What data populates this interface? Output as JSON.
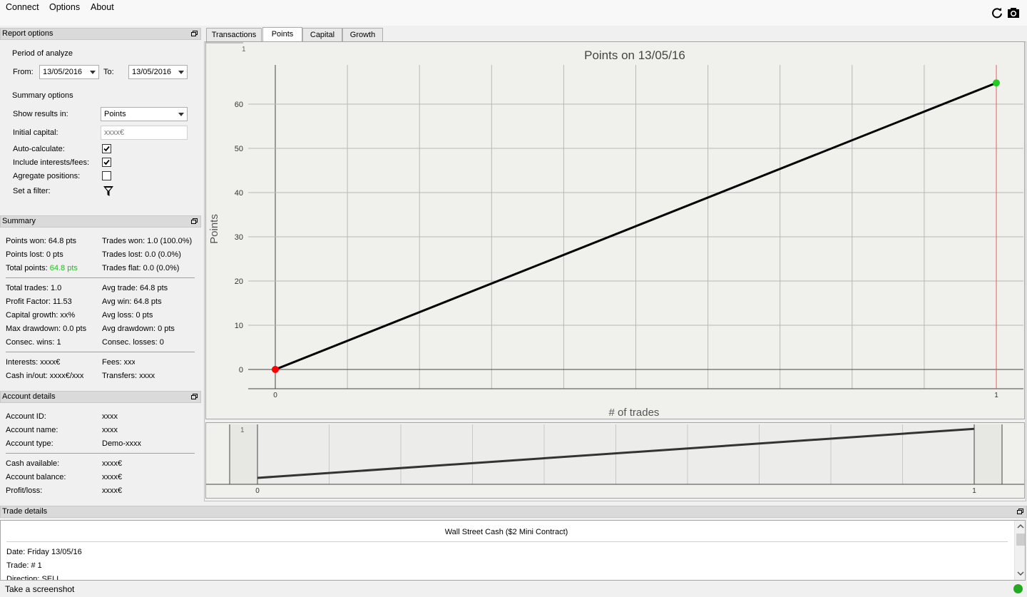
{
  "menu": [
    "Connect",
    "Options",
    "About"
  ],
  "toolbar": {
    "refresh_icon": "refresh-icon",
    "camera_icon": "camera-icon"
  },
  "report_options": {
    "title": "Report options",
    "period_label": "Period of analyze",
    "from_label": "From:",
    "from_value": "13/05/2016",
    "to_label": "To:",
    "to_value": "13/05/2016",
    "summary_options_label": "Summary options",
    "show_results_label": "Show results in:",
    "show_results_value": "Points",
    "initial_capital_label": "Initial capital:",
    "initial_capital_placeholder": "xxxx€",
    "auto_calc_label": "Auto-calculate:",
    "auto_calc_checked": true,
    "include_fees_label": "Include interests/fees:",
    "include_fees_checked": true,
    "aggregate_label": "Agregate positions:",
    "aggregate_checked": false,
    "filter_label": "Set a filter:"
  },
  "summary": {
    "title": "Summary",
    "points_won": "Points won: 64.8 pts",
    "points_lost": "Points lost: 0 pts",
    "total_points_label": "Total points:",
    "total_points_value": "64.8 pts",
    "trades_won": "Trades won: 1.0 (100.0%)",
    "trades_lost": "Trades lost: 0.0 (0.0%)",
    "trades_flat": "Trades flat: 0.0 (0.0%)",
    "total_trades": "Total trades: 1.0",
    "profit_factor": "Profit Factor: 11.53",
    "capital_growth": "Capital growth: xx%",
    "max_drawdown": "Max drawdown: 0.0 pts",
    "consec_wins": "Consec. wins: 1",
    "avg_trade": "Avg trade: 64.8 pts",
    "avg_win": "Avg win: 64.8 pts",
    "avg_loss": "Avg loss: 0 pts",
    "avg_drawdown": "Avg drawdown: 0 pts",
    "consec_losses": "Consec. losses: 0",
    "interests": "Interests: xxxx€",
    "fees": "Fees: xxx",
    "cash_inout": "Cash in/out: xxxx€/xxx",
    "transfers": "Transfers: xxxx"
  },
  "account": {
    "title": "Account details",
    "id_label": "Account ID:",
    "id_value": "xxxx",
    "name_label": "Account name:",
    "name_value": "xxxx",
    "type_label": "Account type:",
    "type_value": "Demo-xxxx",
    "cash_label": "Cash available:",
    "cash_value": "xxxx€",
    "balance_label": "Account balance:",
    "balance_value": "xxxx€",
    "pl_label": "Profit/loss:",
    "pl_value": "xxxx€"
  },
  "tabs": [
    "Transactions",
    "Points",
    "Capital",
    "Growth"
  ],
  "active_tab": "Points",
  "chart_data": {
    "type": "line",
    "title": "Points on 13/05/16",
    "xlabel": "# of trades",
    "ylabel": "Points",
    "x": [
      0,
      1
    ],
    "values": [
      0,
      64.8
    ],
    "xlim": [
      0,
      1
    ],
    "ylim": [
      0,
      65
    ],
    "yticks": [
      0,
      10,
      20,
      30,
      40,
      50,
      60
    ],
    "xticks": [
      0,
      1
    ],
    "corner_label": "1",
    "grid": true,
    "line_color": "#000000",
    "start_marker_color": "#ff0000",
    "end_marker_color": "#22cc22",
    "cursor_color": "#e06060"
  },
  "navigator": {
    "xticks": [
      "0",
      "1"
    ],
    "corner_label": "1"
  },
  "trade_details": {
    "title": "Trade details",
    "instrument": "Wall Street Cash ($2 Mini Contract)",
    "date": "Date: Friday 13/05/16",
    "trade": "Trade: # 1",
    "direction": "Direction: SELL"
  },
  "status": {
    "text": "Take a screenshot",
    "indicator_color": "#22aa22"
  }
}
